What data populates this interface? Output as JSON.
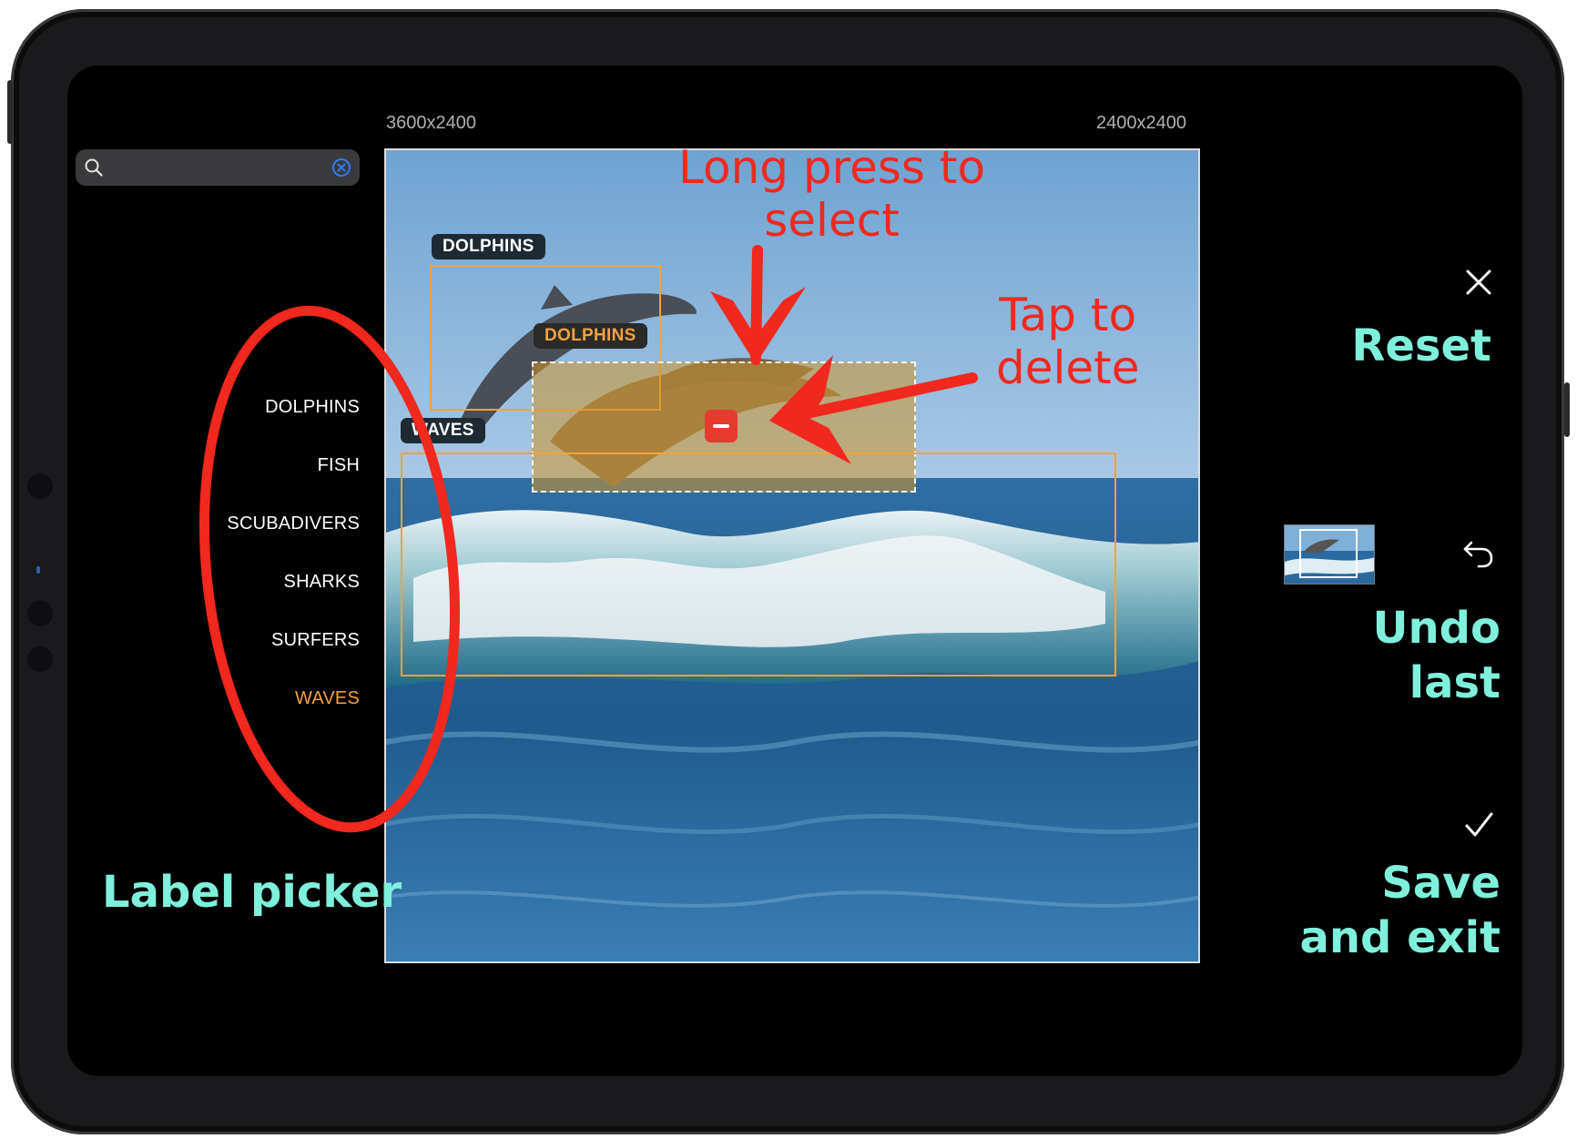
{
  "search": {
    "placeholder": "",
    "value": ""
  },
  "labels": {
    "items": [
      "DOLPHINS",
      "FISH",
      "SCUBADIVERS",
      "SHARKS",
      "SURFERS",
      "WAVES"
    ],
    "selected": "WAVES"
  },
  "image": {
    "original_size": "3600x2400",
    "crop_size": "2400x2400"
  },
  "annotations_on_image": [
    {
      "label": "DOLPHINS",
      "state": "normal"
    },
    {
      "label": "DOLPHINS",
      "state": "selected"
    },
    {
      "label": "WAVES",
      "state": "normal"
    }
  ],
  "controls": {
    "reset_icon": "close-icon",
    "undo_icon": "undo-icon",
    "save_icon": "checkmark-icon"
  },
  "callouts": {
    "long_press": "Long press to\nselect",
    "tap_delete": "Tap to\ndelete",
    "reset": "Reset",
    "undo": "Undo\nlast",
    "save": "Save\nand exit",
    "label_picker": "Label picker"
  },
  "colors": {
    "accent": "#f3a23b",
    "delete": "#e53b2e",
    "callout_red": "#f0281e",
    "callout_cyan": "#7ff0dc"
  }
}
